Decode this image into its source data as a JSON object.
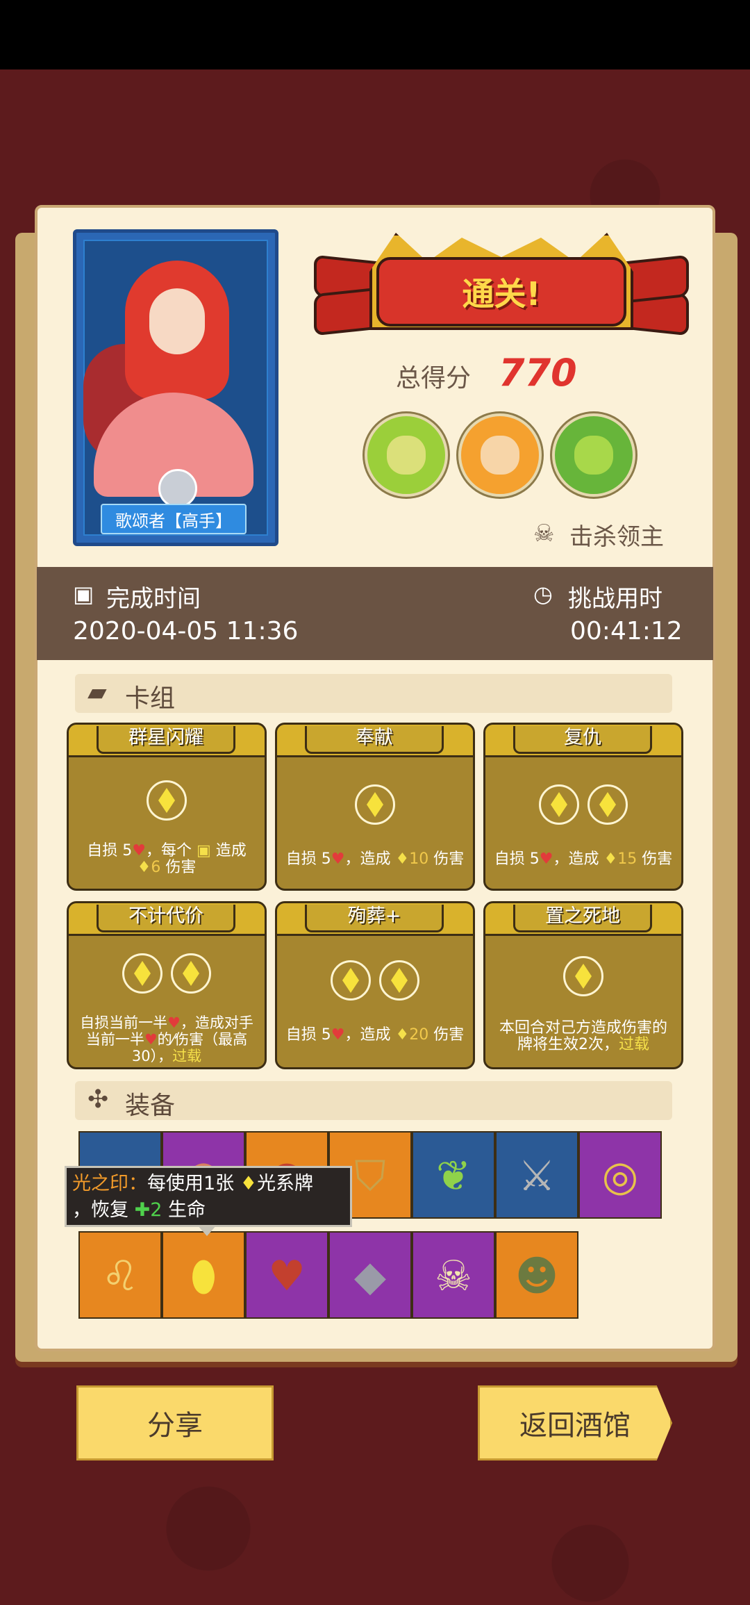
{
  "hero": {
    "name": "歌颂者【高手】"
  },
  "banner": {
    "title": "通关!"
  },
  "score": {
    "label": "总得分",
    "value": "770"
  },
  "bosses_label": "击杀领主",
  "info": {
    "complete_label": "完成时间",
    "complete_value": "2020-04-05 11:36",
    "duration_label": "挑战用时",
    "duration_value": "00:41:12"
  },
  "deck": {
    "header": "卡组",
    "cards": [
      {
        "name": "群星闪耀",
        "desc_a": "自损 5",
        "desc_b": "，每个 ",
        "desc_c": " 造成",
        "desc_d": "6",
        "desc_e": " 伤害"
      },
      {
        "name": "奉献",
        "desc_a": "自损 5",
        "desc_b": "，造成 ",
        "desc_c": "10",
        "desc_d": " 伤害"
      },
      {
        "name": "复仇",
        "desc_a": "自损 5",
        "desc_b": "，造成 ",
        "desc_c": "15",
        "desc_d": " 伤害"
      },
      {
        "name": "不计代价",
        "desc_a": "自损当前一半",
        "desc_b": "，造成对手当前一半",
        "desc_c": "的",
        "desc_d": "伤害（最高30），",
        "desc_e": "过载"
      },
      {
        "name": "殉葬+",
        "desc_a": "自损 5",
        "desc_b": "，造成 ",
        "desc_c": "20",
        "desc_d": " 伤害"
      },
      {
        "name": "置之死地",
        "desc_a": "本回合对己方造成伤害的牌将生效2次，",
        "desc_b": "过载"
      }
    ]
  },
  "equipment": {
    "header": "装备",
    "tooltip": {
      "name": "光之印：",
      "line1": "每使用1张",
      "line1b": "光系牌",
      "line2a": "，恢复",
      "line2b": "2",
      "line2c": " 生命"
    }
  },
  "buttons": {
    "share": "分享",
    "back": "返回酒馆"
  },
  "colors": {
    "panel": "#fbf1d8",
    "info_bar": "#6a5343",
    "card": "#a6862f",
    "button": "#fad96b",
    "score": "#e0342e"
  }
}
